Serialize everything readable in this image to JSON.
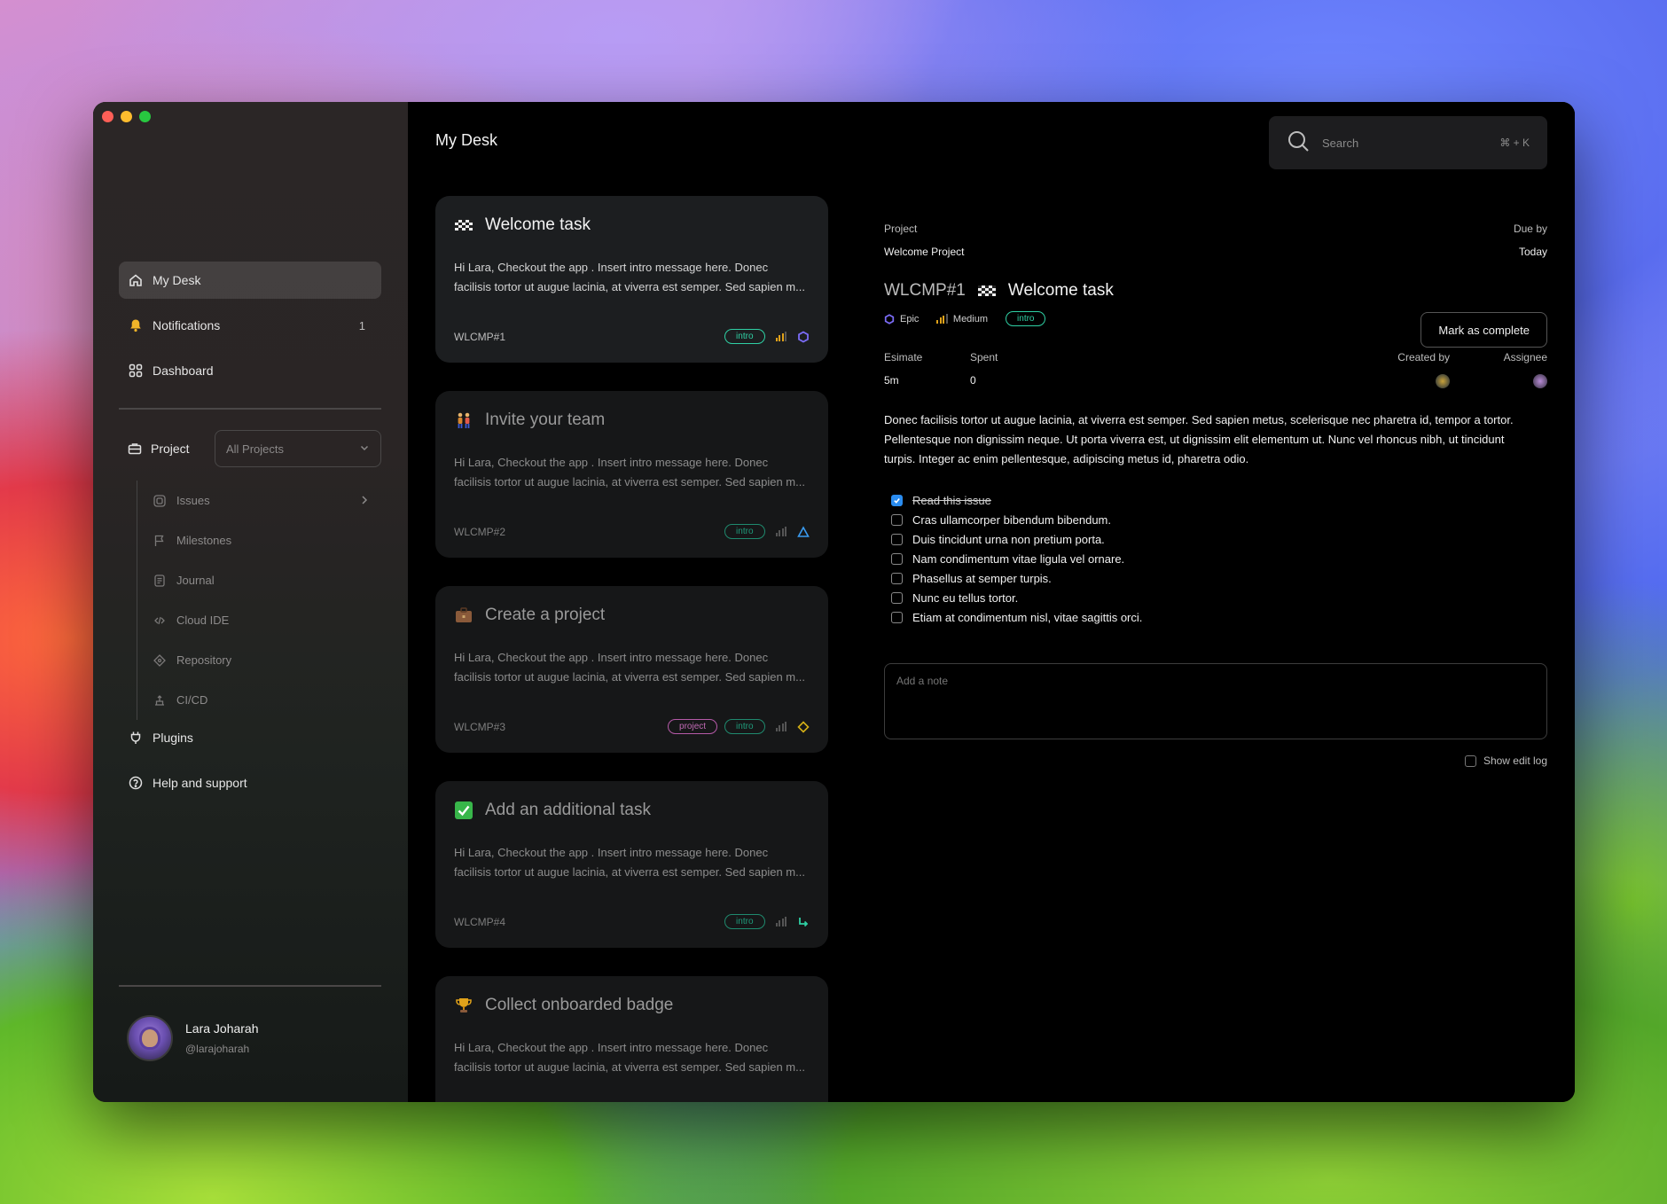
{
  "sidebar": {
    "items": [
      {
        "label": "My Desk",
        "icon": "home-icon"
      },
      {
        "label": "Notifications",
        "icon": "bell-icon",
        "count": "1"
      },
      {
        "label": "Dashboard",
        "icon": "grid-icon"
      }
    ],
    "project_label": "Project",
    "project_select": "All Projects",
    "subitems": [
      {
        "label": "Issues",
        "icon": "issues-icon"
      },
      {
        "label": "Milestones",
        "icon": "flag-icon"
      },
      {
        "label": "Journal",
        "icon": "journal-icon"
      },
      {
        "label": "Cloud IDE",
        "icon": "code-icon"
      },
      {
        "label": "Repository",
        "icon": "repository-icon"
      },
      {
        "label": "CI/CD",
        "icon": "cicd-icon"
      }
    ],
    "bottom_items": [
      {
        "label": "Plugins",
        "icon": "plug-icon"
      },
      {
        "label": "Help and support",
        "icon": "help-icon"
      }
    ],
    "user": {
      "name": "Lara Joharah",
      "handle": "@larajoharah"
    }
  },
  "header": {
    "title": "My Desk",
    "search_placeholder": "Search",
    "search_shortcut": "⌘ + K"
  },
  "cards": [
    {
      "title": "Welcome task",
      "icon": "checkered-flag-icon",
      "line1": "Hi Lara, Checkout the app .  Insert intro message here. Donec",
      "line2": "facilisis tortor ut augue lacinia, at viverra est semper. Sed sapien m...",
      "id": "WLCMP#1",
      "tags": [
        "intro"
      ],
      "status_icon": "epic-hexagon-icon"
    },
    {
      "title": "Invite your team",
      "icon": "people-icon",
      "line1": "Hi Lara, Checkout the app .  Insert intro message here. Donec",
      "line2": "facilisis tortor ut augue lacinia, at viverra est semper. Sed sapien m...",
      "id": "WLCMP#2",
      "tags": [
        "intro"
      ],
      "status_icon": "triangle-icon"
    },
    {
      "title": "Create a project",
      "icon": "briefcase-icon",
      "line1": "Hi Lara, Checkout the app .  Insert intro message here. Donec",
      "line2": "facilisis tortor ut augue lacinia, at viverra est semper. Sed sapien m...",
      "id": "WLCMP#3",
      "tags": [
        "project",
        "intro"
      ],
      "status_icon": "diamond-icon"
    },
    {
      "title": "Add an additional task",
      "icon": "check-mark-icon",
      "line1": "Hi Lara, Checkout the app .  Insert intro message here. Donec",
      "line2": "facilisis tortor ut augue lacinia, at viverra est semper. Sed sapien m...",
      "id": "WLCMP#4",
      "tags": [
        "intro"
      ],
      "status_icon": "subtask-arrow-icon"
    },
    {
      "title": "Collect onboarded badge",
      "icon": "trophy-icon",
      "line1": "Hi Lara, Checkout the app .  Insert intro message here. Donec",
      "line2": "facilisis tortor ut augue lacinia, at viverra est semper. Sed sapien m..."
    }
  ],
  "detail": {
    "project_label": "Project",
    "project_value": "Welcome Project",
    "due_label": "Due by",
    "due_value": "Today",
    "id": "WLCMP#1",
    "title": "Welcome task",
    "mark_complete": "Mark as complete",
    "type": "Epic",
    "priority": "Medium",
    "tag": "intro",
    "estimate_label": "Esimate",
    "estimate_value": "5m",
    "spent_label": "Spent",
    "spent_value": "0",
    "created_by_label": "Created by",
    "assignee_label": "Assignee",
    "description": [
      "Donec facilisis tortor ut augue lacinia, at viverra est semper. Sed sapien metus, scelerisque nec pharetra id, tempor a tortor.",
      "Pellentesque non dignissim neque. Ut porta viverra est, ut dignissim elit elementum ut. Nunc vel rhoncus nibh, ut tincidunt",
      "turpis. Integer ac enim pellentesque, adipiscing metus id, pharetra odio."
    ],
    "checklist": [
      {
        "text": "Read this issue",
        "checked": true
      },
      {
        "text": "Cras ullamcorper bibendum bibendum.",
        "checked": false
      },
      {
        "text": "Duis tincidunt urna non pretium porta.",
        "checked": false
      },
      {
        "text": "Nam condimentum vitae ligula vel ornare.",
        "checked": false
      },
      {
        "text": "Phasellus at semper turpis.",
        "checked": false
      },
      {
        "text": "Nunc eu tellus tortor.",
        "checked": false
      },
      {
        "text": "Etiam at condimentum nisl, vitae sagittis orci.",
        "checked": false
      }
    ],
    "note_placeholder": "Add a note",
    "show_edit_log": "Show edit log"
  },
  "colors": {
    "accent_teal": "#2fd0a4",
    "epic_purple": "#7b6cf6",
    "priority_orange": "#e0a21a",
    "checkbox_blue": "#2a8cf0"
  }
}
